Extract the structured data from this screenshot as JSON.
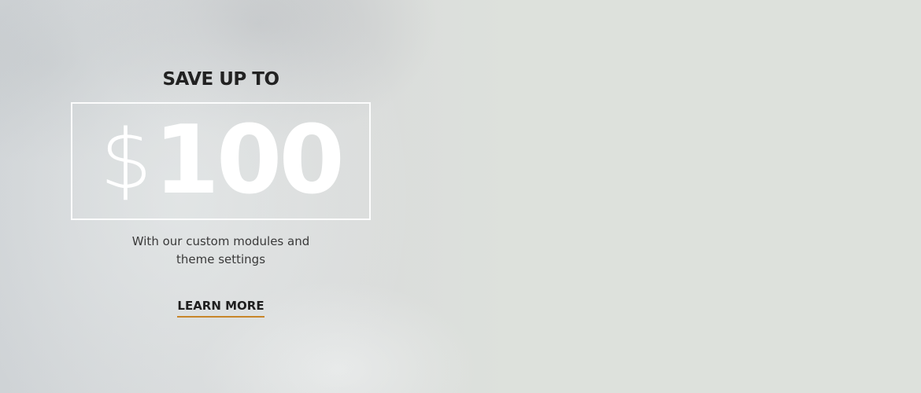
{
  "promo": {
    "eyebrow": "SAVE UP TO",
    "currency": "$",
    "amount": "100",
    "subtitle": "With our custom modules and theme settings",
    "cta_label": "LEARN MORE"
  },
  "colors": {
    "accent": "#c8862a",
    "text_dark": "#222222",
    "price_white": "#ffffff",
    "background": "#dde0dc"
  }
}
